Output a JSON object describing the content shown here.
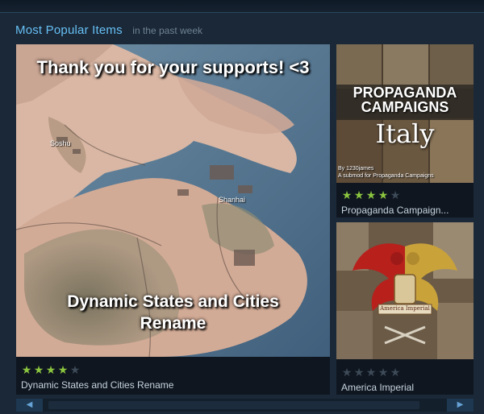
{
  "header": {
    "title": "Most Popular Items",
    "subtitle": "in the past week"
  },
  "items": [
    {
      "title": "Dynamic States and Cities Rename",
      "rating": 4,
      "banner": "Thank you for your supports! <3",
      "caption": "Dynamic States and Cities Rename",
      "map_labels": [
        "Soshu",
        "Shanhai"
      ]
    },
    {
      "title": "Propaganda Campaign...",
      "rating": 4,
      "art_title_line1": "PROPAGANDA",
      "art_title_line2": "CAMPAIGNS",
      "art_script": "Italy",
      "art_credit_1": "By 1230james",
      "art_credit_2": "A submod for Propaganda Campaigns"
    },
    {
      "title": "America Imperial",
      "rating": 0,
      "art_banner": "America Imperial"
    }
  ],
  "icons": {
    "star": "star-icon",
    "scroll_left": "arrow-left-icon",
    "scroll_right": "arrow-right-icon"
  },
  "colors": {
    "accent": "#66c0f4",
    "star_on": "#8bc53f",
    "star_off": "#3d4a57",
    "background": "#1b2838"
  },
  "scroll": {
    "left_glyph": "◀",
    "right_glyph": "▶"
  }
}
